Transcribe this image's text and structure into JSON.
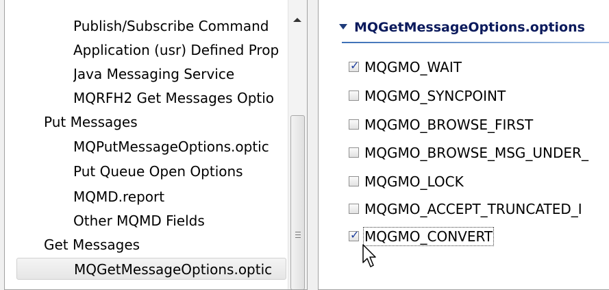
{
  "left_tree": {
    "items": [
      {
        "label": "Publish/Subscribe Command",
        "level": 2
      },
      {
        "label": "Application (usr) Defined Prop",
        "level": 2
      },
      {
        "label": "Java Messaging Service",
        "level": 2
      },
      {
        "label": "MQRFH2 Get Messages Optio",
        "level": 2
      },
      {
        "label": "Put Messages",
        "level": 1
      },
      {
        "label": "MQPutMessageOptions.optic",
        "level": 2
      },
      {
        "label": "Put Queue Open Options",
        "level": 2
      },
      {
        "label": "MQMD.report",
        "level": 2
      },
      {
        "label": "Other MQMD Fields",
        "level": 2
      },
      {
        "label": "Get Messages",
        "level": 1
      },
      {
        "label": "MQGetMessageOptions.optic",
        "level": 2,
        "selected": true
      }
    ]
  },
  "right_section": {
    "title": "MQGetMessageOptions.options",
    "options": [
      {
        "label": "MQGMO_WAIT",
        "checked": true
      },
      {
        "label": "MQGMO_SYNCPOINT",
        "checked": false
      },
      {
        "label": "MQGMO_BROWSE_FIRST",
        "checked": false
      },
      {
        "label": "MQGMO_BROWSE_MSG_UNDER_",
        "checked": false
      },
      {
        "label": "MQGMO_LOCK",
        "checked": false
      },
      {
        "label": "MQGMO_ACCEPT_TRUNCATED_I",
        "checked": false
      },
      {
        "label": "MQGMO_CONVERT",
        "checked": true,
        "focused": true
      }
    ]
  },
  "colors": {
    "header_text": "#0b1a5c",
    "check_mark": "#1a3c9c",
    "selection_bg": "#e6e6e6"
  },
  "icons": {
    "expand_twisty": "triangle-down-icon",
    "scroll_up": "chevron-up-icon",
    "cursor": "mouse-pointer-icon"
  }
}
